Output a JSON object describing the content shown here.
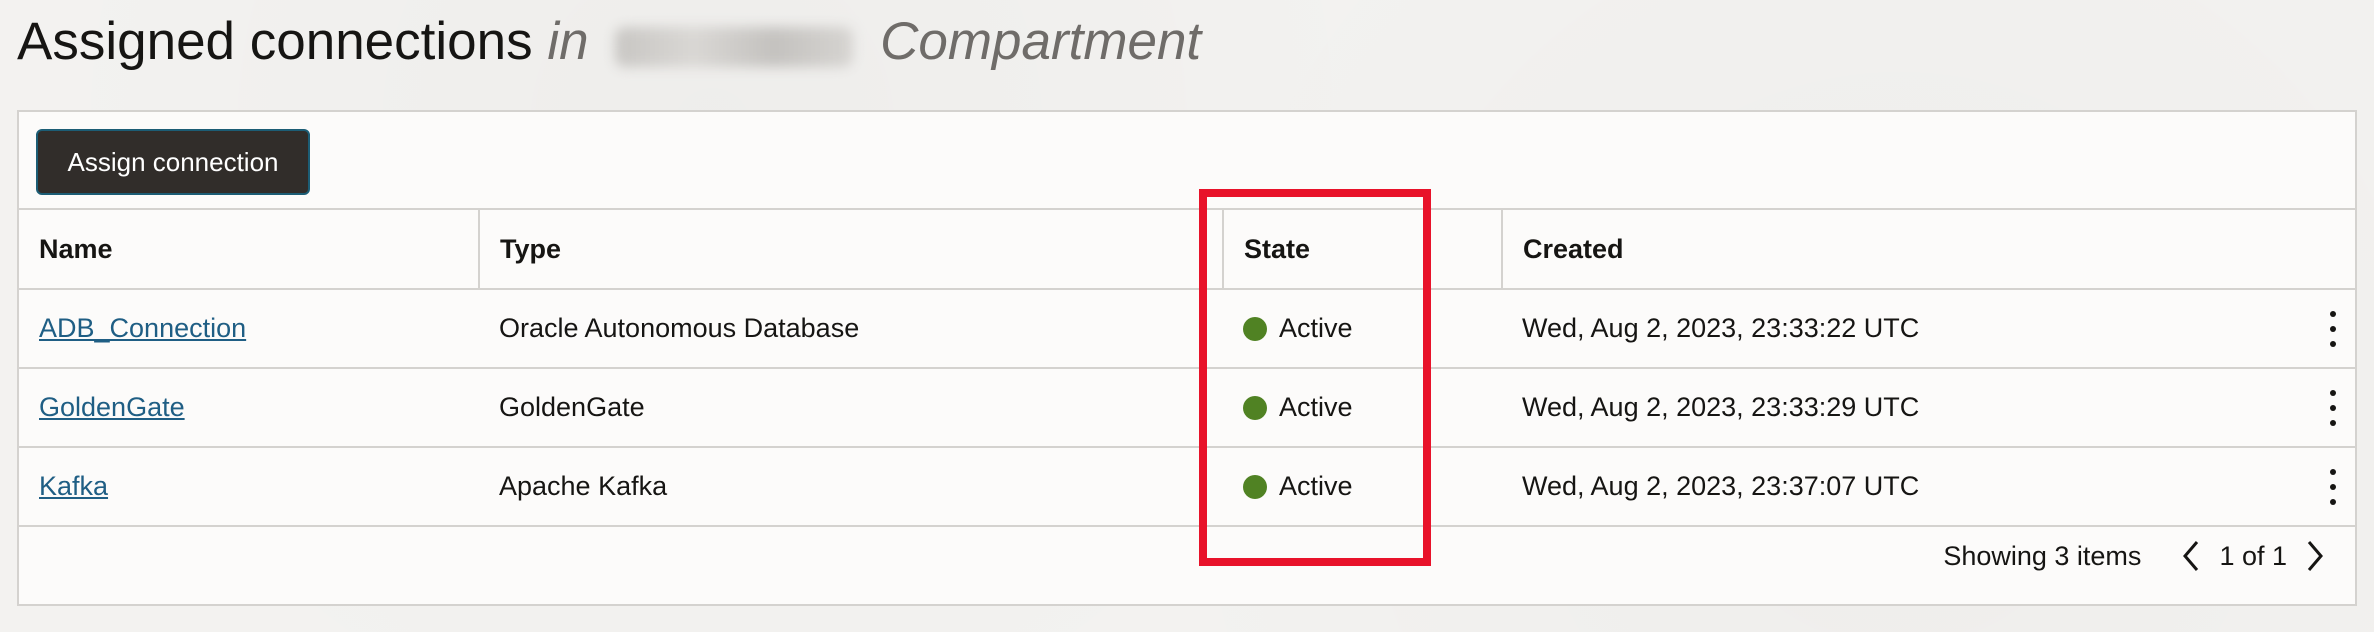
{
  "header": {
    "title": "Assigned connections",
    "in_word": "in",
    "compartment_label": "Compartment"
  },
  "toolbar": {
    "assign_label": "Assign connection"
  },
  "table": {
    "columns": [
      "Name",
      "Type",
      "State",
      "Created"
    ],
    "rows": [
      {
        "name": "ADB_Connection",
        "type": "Oracle Autonomous Database",
        "state": "Active",
        "created": "Wed, Aug 2, 2023, 23:33:22 UTC"
      },
      {
        "name": "GoldenGate",
        "type": "GoldenGate",
        "state": "Active",
        "created": "Wed, Aug 2, 2023, 23:33:29 UTC"
      },
      {
        "name": "Kafka",
        "type": "Apache Kafka",
        "state": "Active",
        "created": "Wed, Aug 2, 2023, 23:37:07 UTC"
      }
    ]
  },
  "footer": {
    "count_text": "Showing 3 items",
    "pager_text": "1 of 1"
  },
  "icons": {
    "state_active": "green-dot-icon",
    "row_actions": "kebab-menu-icon",
    "prev": "chevron-left-icon",
    "next": "chevron-right-icon"
  },
  "colors": {
    "active_state": "#508223",
    "link": "#1f5e84",
    "button_bg": "#312d2a",
    "highlight": "#e8122a"
  }
}
